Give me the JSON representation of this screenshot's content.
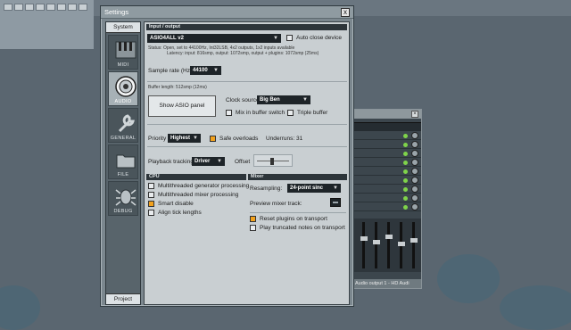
{
  "window": {
    "title": "Settings",
    "close_glyph": "x"
  },
  "sidebar": {
    "top_tab": "System",
    "items": [
      {
        "label": "MIDI",
        "icon": "midi-icon"
      },
      {
        "label": "AUDIO",
        "icon": "speaker-icon"
      },
      {
        "label": "GENERAL",
        "icon": "wrench-icon"
      },
      {
        "label": "FILE",
        "icon": "folder-icon"
      },
      {
        "label": "DEBUG",
        "icon": "bug-icon"
      }
    ],
    "bottom_tab": "Project"
  },
  "io": {
    "header": "Input / output",
    "device": "ASIO4ALL v2",
    "auto_close_label": "Auto close device",
    "status_line1": "Status:  Open, set to 44100Hz, Int32LSB, 4x2 outputs, 1x2 inputs available",
    "status_line2": "Latency: input: 816smp, output: 1072smp, output + plugins: 1072smp (25ms)",
    "sample_rate_label": "Sample rate (Hz)",
    "sample_rate": "44100",
    "buffer_length": "Buffer length: 512smp (12ms)",
    "show_asio_button": "Show ASIO panel",
    "clock_source_label": "Clock source",
    "clock_source": "Big Ben",
    "mix_in_buffer_label": "Mix in buffer switch",
    "triple_buffer_label": "Triple buffer",
    "priority_label": "Priority",
    "priority": "Highest",
    "safe_overloads_label": "Safe overloads",
    "underruns": "Underruns: 31",
    "playback_tracking_label": "Playback tracking",
    "playback_tracking": "Driver",
    "offset_label": "Offset"
  },
  "cpu": {
    "header": "CPU",
    "options": [
      {
        "label": "Multithreaded generator processing",
        "checked": false
      },
      {
        "label": "Multithreaded mixer processing",
        "checked": false
      },
      {
        "label": "Smart disable",
        "checked": true
      },
      {
        "label": "Align tick lengths",
        "checked": false
      }
    ]
  },
  "mixer": {
    "header": "Mixer",
    "resampling_label": "Resampling:",
    "resampling": "24-point sinc",
    "preview_track_label": "Preview mixer track:",
    "reset_plugins_label": "Reset plugins on transport",
    "reset_plugins_checked": true,
    "play_truncated_label": "Play truncated notes on transport",
    "play_truncated_checked": false
  },
  "background_mixer": {
    "footer": "Audio output 1 - HD Audi"
  },
  "colors": {
    "accent": "#f2a11d",
    "dropdown_bg": "#1e2428",
    "panel_bg": "#c9cfd2"
  }
}
